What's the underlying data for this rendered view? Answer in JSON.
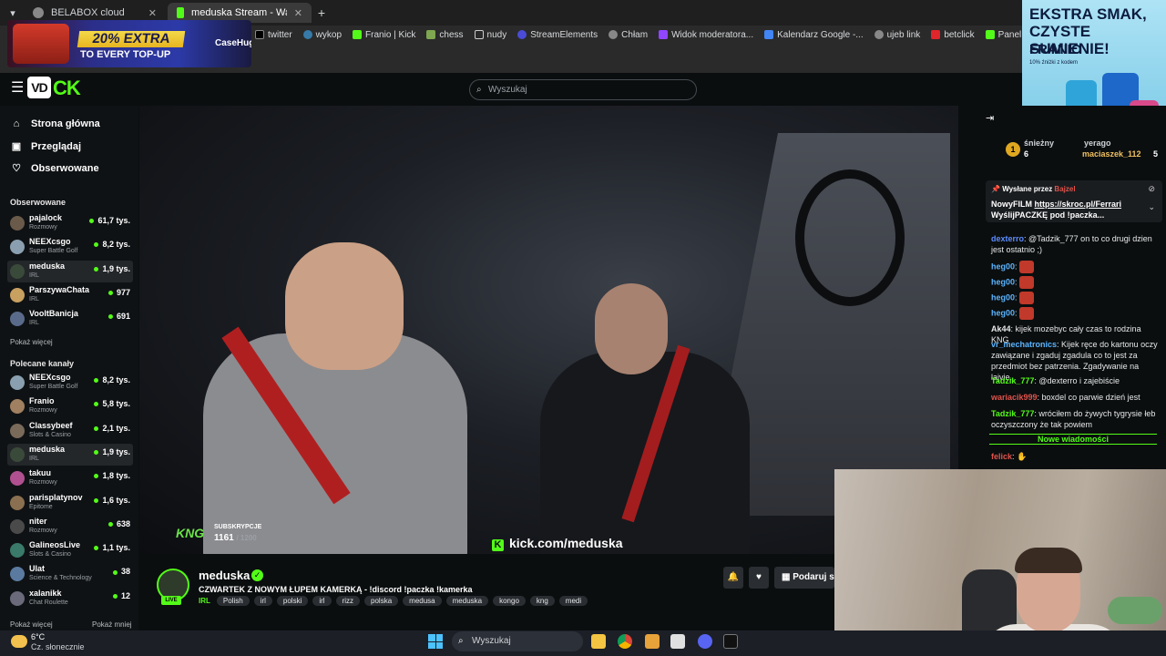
{
  "browser": {
    "tabs": [
      {
        "title": "BELABOX cloud"
      },
      {
        "title": "meduska Stream - Watch Live o"
      }
    ],
    "bookmarks": [
      "twitter",
      "wykop",
      "Franio | Kick",
      "chess",
      "nudy",
      "StreamElements",
      "Chłam",
      "Widok moderatora...",
      "Kalendarz Google -...",
      "ujeb link",
      "betclick",
      "Panel moderatora |..."
    ]
  },
  "ads": {
    "left": {
      "headline": "20% EXTRA",
      "sub": "TO EVERY TOP-UP",
      "brand": "CaseHug"
    },
    "right": {
      "headline": "EKSTRA SMAK, CZYSTE SUMIENIE!",
      "brand": "FRANIO",
      "note": "10% źniżki z kodem"
    }
  },
  "header": {
    "search_placeholder": "Wyszukaj"
  },
  "sidebar": {
    "nav": [
      {
        "label": "Strona główna",
        "icon": "home-icon"
      },
      {
        "label": "Przeglądaj",
        "icon": "browse-icon"
      },
      {
        "label": "Obserwowane",
        "icon": "heart-icon"
      }
    ],
    "following_title": "Obserwowane",
    "following": [
      {
        "name": "pajalock",
        "category": "Rozmowy",
        "viewers": "61,7 tys.",
        "color": "#6a5a4a"
      },
      {
        "name": "NEEXcsgo",
        "category": "Super Battle Golf",
        "viewers": "8,2 tys.",
        "color": "#8aa0b0"
      },
      {
        "name": "meduska",
        "category": "IRL",
        "viewers": "1,9 tys.",
        "color": "#3a4a3a"
      },
      {
        "name": "ParszywaChata",
        "category": "IRL",
        "viewers": "977",
        "color": "#c8a060"
      },
      {
        "name": "VooltBanicja",
        "category": "IRL",
        "viewers": "691",
        "color": "#5a6a8a"
      }
    ],
    "following_more": "Pokaż więcej",
    "recommended_title": "Polecane kanały",
    "recommended": [
      {
        "name": "NEEXcsgo",
        "category": "Super Battle Golf",
        "viewers": "8,2 tys.",
        "color": "#8aa0b0"
      },
      {
        "name": "Franio",
        "category": "Rozmowy",
        "viewers": "5,8 tys.",
        "color": "#a08060"
      },
      {
        "name": "Classybeef",
        "category": "Slots & Casino",
        "viewers": "2,1 tys.",
        "color": "#7a6a5a"
      },
      {
        "name": "meduska",
        "category": "IRL",
        "viewers": "1,9 tys.",
        "color": "#3a4a3a"
      },
      {
        "name": "takuu",
        "category": "Rozmowy",
        "viewers": "1,8 tys.",
        "color": "#b05090"
      },
      {
        "name": "parisplatynov",
        "category": "Epitome",
        "viewers": "1,6 tys.",
        "color": "#8a7050"
      },
      {
        "name": "niter",
        "category": "Rozmowy",
        "viewers": "638",
        "color": "#4a4a4a"
      },
      {
        "name": "GalineosLive",
        "category": "Slots & Casino",
        "viewers": "1,1 tys.",
        "color": "#3a7a6a"
      },
      {
        "name": "Ulat",
        "category": "Science & Technology",
        "viewers": "38",
        "color": "#5a7aa0"
      },
      {
        "name": "xalanikk",
        "category": "Chat Roulette",
        "viewers": "12",
        "color": "#6a6a7a"
      }
    ],
    "show_more": "Pokaż więcej",
    "show_less": "Pokaż mniej"
  },
  "video": {
    "sub_label": "SUBSKRYPCJE",
    "sub_count": "1161",
    "sub_goal": "/ 1200",
    "kng": "KNG",
    "watermark": "kick.com/meduska"
  },
  "stream": {
    "name": "meduska",
    "live": "LIVE",
    "title": "CZWARTEK Z NOWYM ŁUPEM KAMERKĄ - !discord !paczka !kamerka",
    "category": "IRL",
    "tags": [
      "Polish",
      "irl",
      "polski",
      "irl",
      "rizz",
      "polska",
      "medusa",
      "meduska",
      "kongo",
      "kng",
      "medi"
    ],
    "gift_label": "Podaruj s"
  },
  "chat": {
    "leader": {
      "rank": "1",
      "user1": "śnieżny",
      "count1": "6",
      "user2": "yerago",
      "user3": "maciaszek_112",
      "count3": "5"
    },
    "pinned_by": "Wysłane przez",
    "pinned_user": "Bajzel",
    "pinned_msg_prefix": "NowyFILM",
    "pinned_link": "https://skroc.pl/Ferrari",
    "pinned_msg_suffix": "WyślijPACZKĘ pod !paczka...",
    "messages": [
      {
        "user": "dexterro",
        "color": "#5b8cff",
        "text": ": @Tadzik_777 on to co drugi dzien jest ostatnio ;)"
      },
      {
        "user": "heg00",
        "color": "#5bb4ff",
        "text": ":",
        "emote": true
      },
      {
        "user": "heg00",
        "color": "#5bb4ff",
        "text": ":",
        "emote": true
      },
      {
        "user": "heg00",
        "color": "#5bb4ff",
        "text": ":",
        "emote": true
      },
      {
        "user": "heg00",
        "color": "#5bb4ff",
        "text": ":",
        "emote": true
      },
      {
        "user": "Ak44",
        "color": "#e8eaec",
        "text": ": kijek mozebyc cały czas to rodzina KNG"
      },
      {
        "user": "vr_mechatronics",
        "color": "#5bb4ff",
        "text": ": Kijek ręce do kartonu oczy zawiązane i zgaduj zgadula co to jest za przedmiot bez patrzenia. Zgadywanie na lajvie."
      },
      {
        "user": "Tadzik_777",
        "color": "#53fc18",
        "text": ": @dexterro i zajebiście"
      },
      {
        "user": "wariacik999",
        "color": "#e0524b",
        "text": ": boxdel co parwie dzień jest"
      },
      {
        "user": "Tadzik_777",
        "color": "#53fc18",
        "text": ": wróciłem do żywych tygrysie łeb oczyszczony że tak powiem"
      }
    ],
    "new_messages": "Nowe wiadomości",
    "last_user": "felick"
  },
  "taskbar": {
    "temp": "6°C",
    "weather": "Cz. słonecznie",
    "search": "Wyszukaj"
  }
}
